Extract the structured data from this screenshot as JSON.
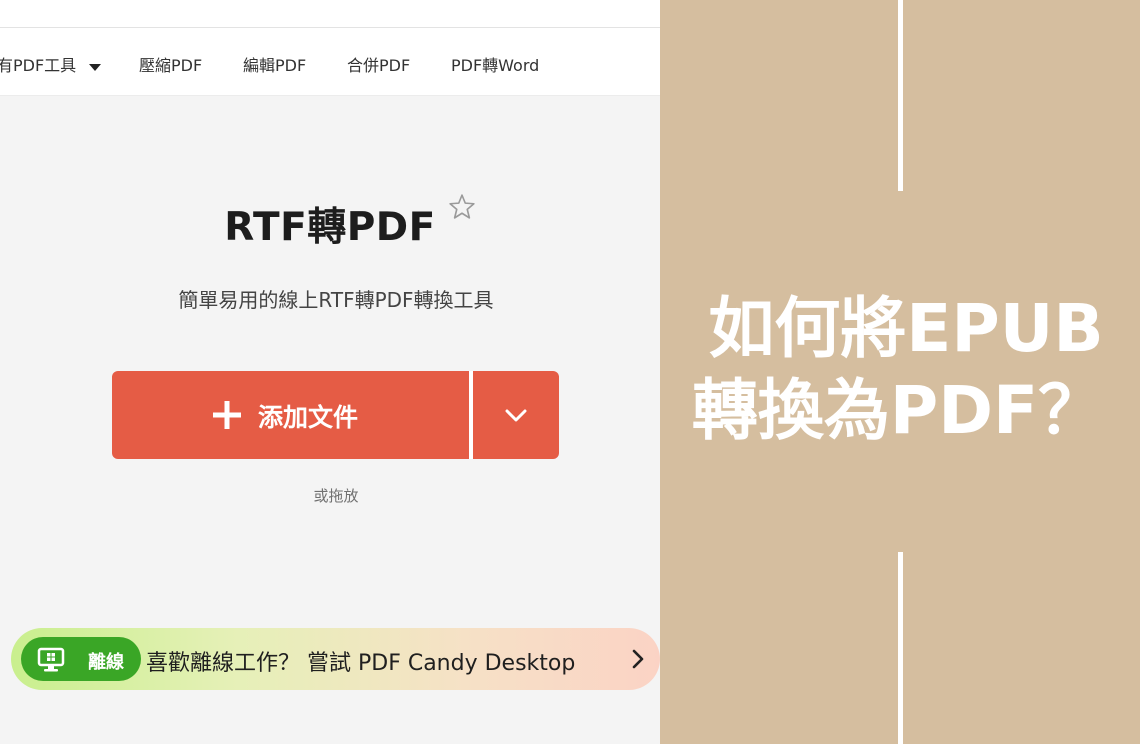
{
  "nav": {
    "all_tools": "有PDF工具",
    "compress": "壓縮PDF",
    "edit": "編輯PDF",
    "merge": "合併PDF",
    "pdf_to_word": "PDF轉Word"
  },
  "main": {
    "title": "RTF轉PDF",
    "subtitle": "簡單易用的線上RTF轉PDF轉換工具",
    "add_file_label": "添加文件",
    "drag_hint": "或拖放"
  },
  "promo": {
    "badge": "離線",
    "text": "喜歡離線工作？ 嘗試 PDF Candy Desktop"
  },
  "banner": {
    "line1": "如何將EPUB",
    "line2": "轉換為PDF？"
  },
  "colors": {
    "accent": "#e55c45",
    "banner_bg": "#d5be9f",
    "badge_green": "#3aa626"
  },
  "icons": {
    "star": "star-outline-icon",
    "plus": "plus-icon",
    "dropdown": "chevron-down-icon",
    "desktop": "desktop-monitor-icon",
    "promo_arrow": "chevron-right-icon",
    "nav_caret": "caret-down-icon"
  }
}
